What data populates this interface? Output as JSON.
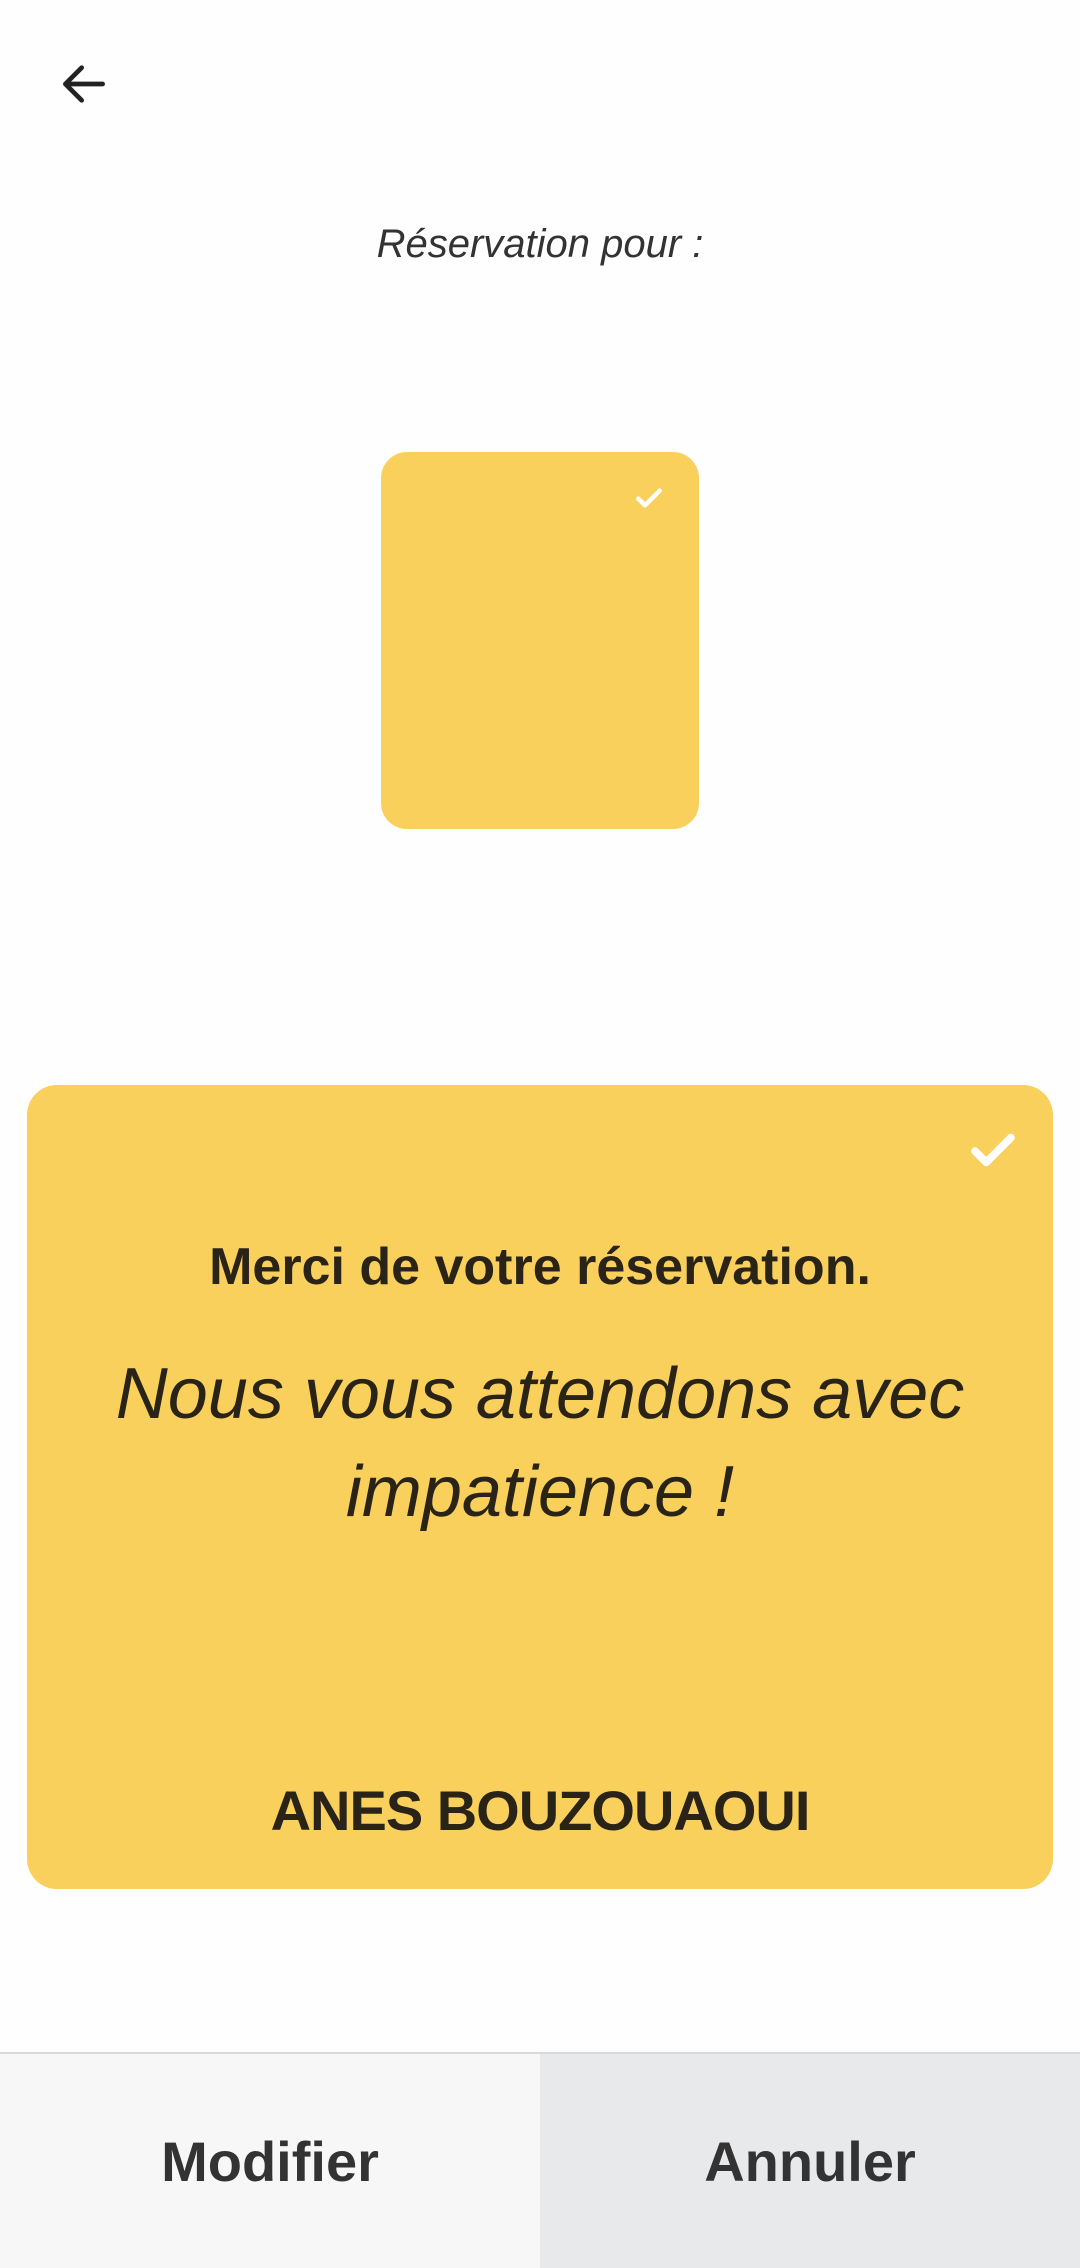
{
  "header": {
    "back_icon": "arrow-left-icon",
    "subtitle": "Réservation pour :"
  },
  "selection_card": {
    "check_icon": "check-icon",
    "selected": true
  },
  "confirmation_card": {
    "check_icon": "check-icon",
    "thanks": "Merci de votre réservation.",
    "message": "Nous vous attendons avec impatience !",
    "name": "ANES BOUZOUAOUI"
  },
  "actions": {
    "modify_label": "Modifier",
    "cancel_label": "Annuler"
  },
  "colors": {
    "accent": "#fad05c",
    "text_dark": "#2a2418",
    "cancel_bg": "#e8e9eb"
  }
}
